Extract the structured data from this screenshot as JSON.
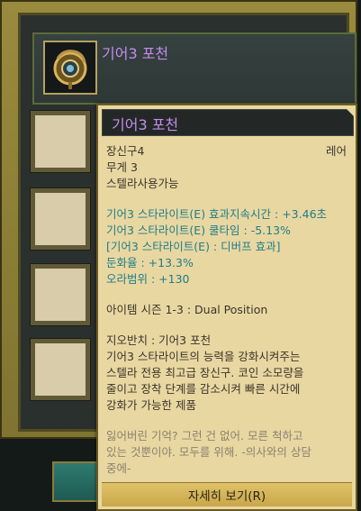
{
  "item": {
    "name": "기어3 포천",
    "icon": "gear-pouch-icon"
  },
  "tooltip": {
    "title": "기어3 포천",
    "category": "장신구4",
    "rarity": "레어",
    "weight": "무게 3",
    "usable": "스텔라사용가능",
    "stats": [
      "기어3 스타라이트(E) 효과지속시간 : +3.46초",
      "기어3 스타라이트(E) 쿨타임 : -5.13%",
      "[기어3 스타라이트(E) : 디버프 효과]",
      "둔화율 : +13.3%",
      "오라범위 : +130"
    ],
    "season": "아이템 시즌 1-3 : Dual Position",
    "description": [
      "지오반치 : 기어3 포천",
      "기어3 스타라이트의 능력을 강화시켜주는",
      "스텔라 전용 최고급 장신구. 코인 소모량을",
      "줄이고 장착 단계를 감소시켜 빠른 시간에",
      "강화가 가능한 제품"
    ],
    "flavor": [
      "잃어버린 기억? 그런 건 없어. 모른 척하고",
      "있는 것뿐이야. 모두를 위해. -의사와의 상담",
      "중에-"
    ],
    "details_button": "자세히 보기(R)"
  },
  "colors": {
    "item_name": "#c58cf0",
    "stat_text": "#1f7d86",
    "tooltip_bg": "#e9d7a2"
  }
}
